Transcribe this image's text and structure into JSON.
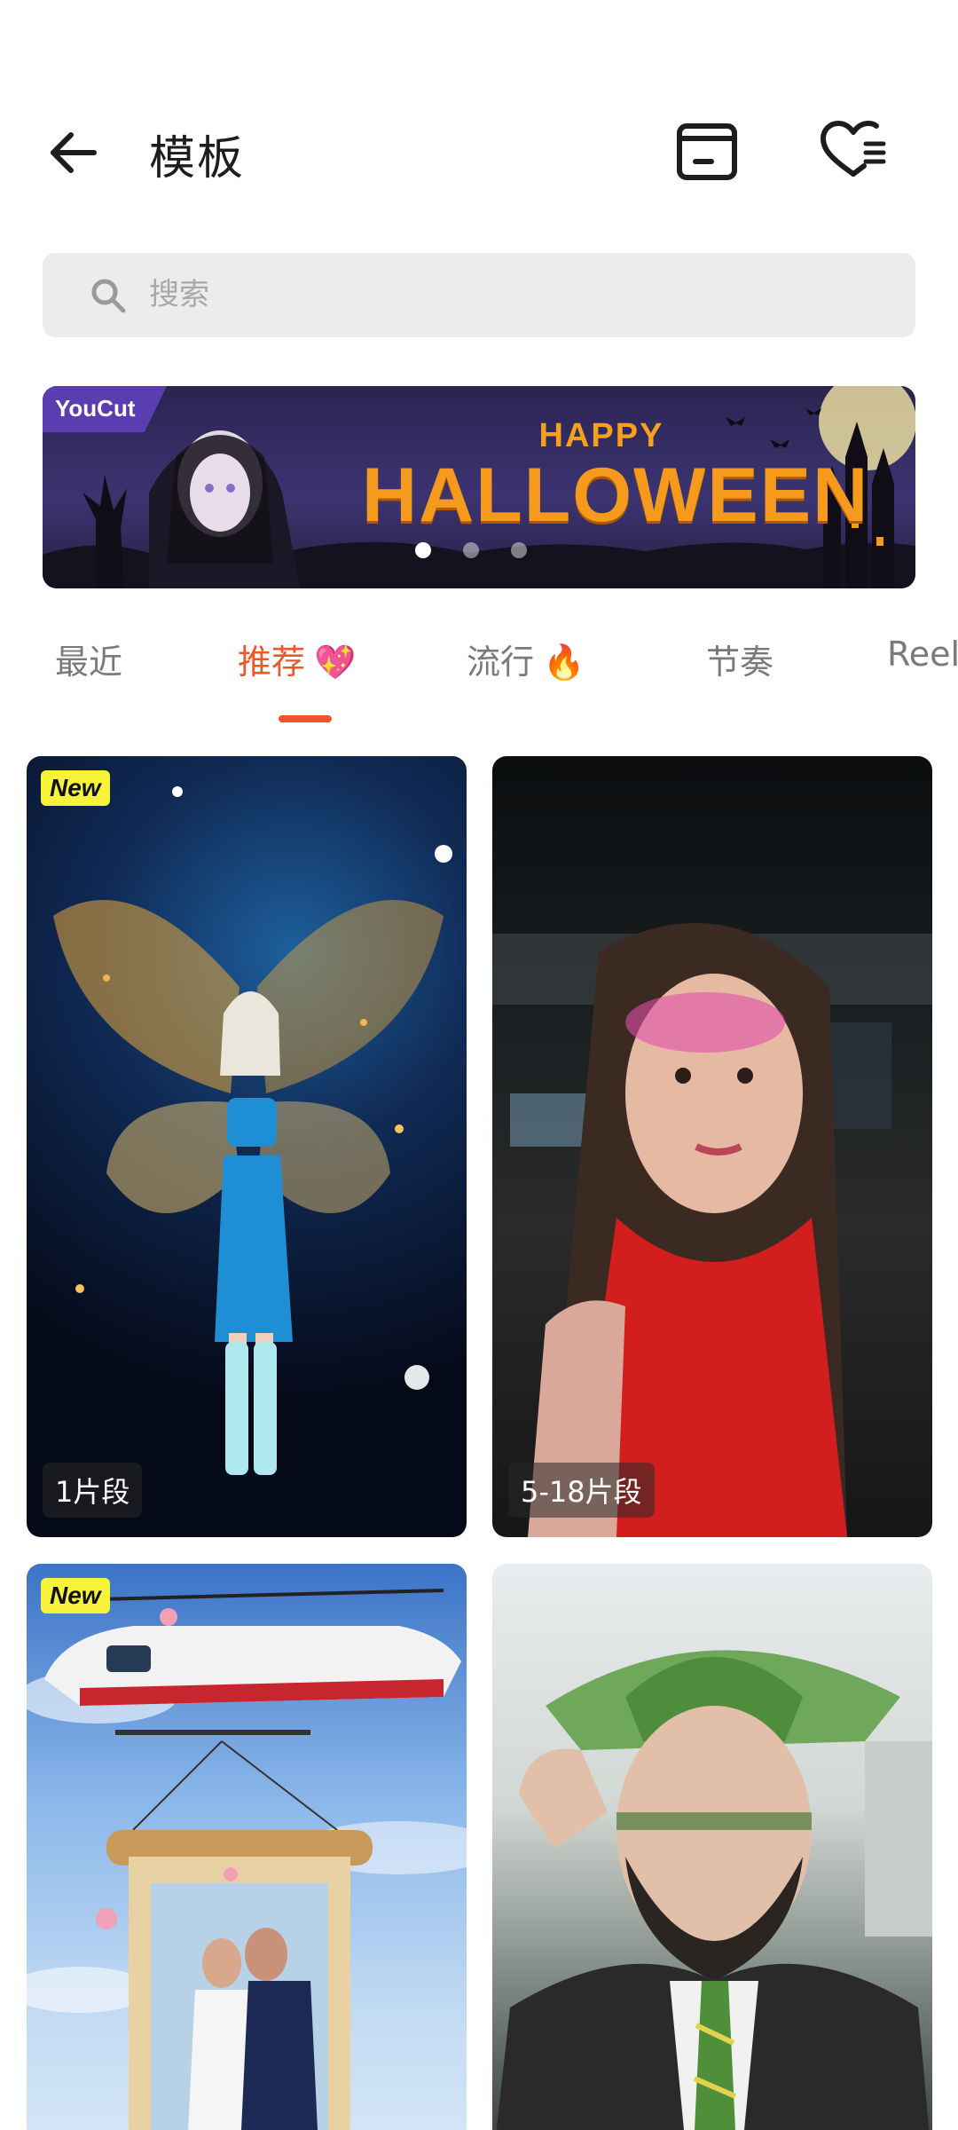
{
  "header": {
    "title": "模板",
    "back_icon": "arrow-left-icon",
    "drafts_icon": "drafts-box-icon",
    "favorites_icon": "heart-list-icon"
  },
  "search": {
    "placeholder": "搜索"
  },
  "banner": {
    "brand": "YouCut",
    "line1": "HAPPY",
    "line2": "HALLOWEEN",
    "slide_count": 3,
    "active_slide": 1
  },
  "tabs": [
    {
      "label": "最近",
      "emoji": ""
    },
    {
      "label": "推荐",
      "emoji": "💖"
    },
    {
      "label": "流行",
      "emoji": "🔥"
    },
    {
      "label": "节奏",
      "emoji": ""
    },
    {
      "label": "Reel",
      "emoji": ""
    }
  ],
  "active_tab": 1,
  "colors": {
    "accent": "#f0562a",
    "new_badge": "#f7f23a"
  },
  "cards": [
    {
      "badge": "New",
      "segments": "1片段",
      "theme": "butterfly-fairy"
    },
    {
      "badge": "",
      "segments": "5-18片段",
      "theme": "portrait-glow"
    },
    {
      "badge": "New",
      "segments": "",
      "theme": "helicopter-wedding"
    },
    {
      "badge": "",
      "segments": "",
      "theme": "cartoon-man-hat"
    }
  ]
}
